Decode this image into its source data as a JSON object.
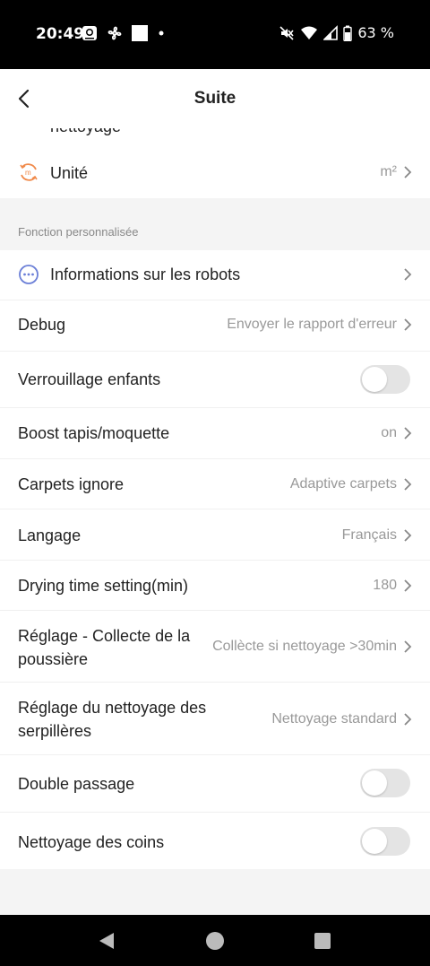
{
  "status_bar": {
    "time": "20:49",
    "battery": "63 %",
    "icons": [
      "photo-icon",
      "fan-icon",
      "square-icon",
      "dot-icon",
      "mute-icon",
      "wifi-icon",
      "signal-icon",
      "battery-icon"
    ]
  },
  "header": {
    "title": "Suite",
    "back_icon": "back-arrow-icon"
  },
  "clipped_row": {
    "text": "nettoyage"
  },
  "unit_row": {
    "label": "Unité",
    "value": "m²",
    "icon": "unit-icon"
  },
  "section": {
    "label": "Fonction personnalisée"
  },
  "rows": [
    {
      "label": "Informations sur les robots",
      "value": ""
    },
    {
      "label": "Debug",
      "value": "Envoyer le rapport d'erreur"
    },
    {
      "label": "Verrouillage enfants",
      "toggle": false
    },
    {
      "label": "Boost tapis/moquette",
      "value": "on"
    },
    {
      "label": "Carpets ignore",
      "value": "Adaptive carpets"
    },
    {
      "label": "Langage",
      "value": "Français"
    },
    {
      "label": "Drying time setting(min)",
      "value": "180"
    },
    {
      "label": "Réglage - Collecte de la poussière",
      "value": "Collècte si nettoyage >30min"
    },
    {
      "label": "Réglage du nettoyage des serpillères",
      "value": "Nettoyage standard"
    },
    {
      "label": "Double passage",
      "toggle": false
    },
    {
      "label": "Nettoyage des coins",
      "toggle": false
    }
  ],
  "colors": {
    "accent_unit_icon": "#f08a4b",
    "info_icon": "#6b7fd7",
    "toggle_off": "#e4e4e4"
  }
}
